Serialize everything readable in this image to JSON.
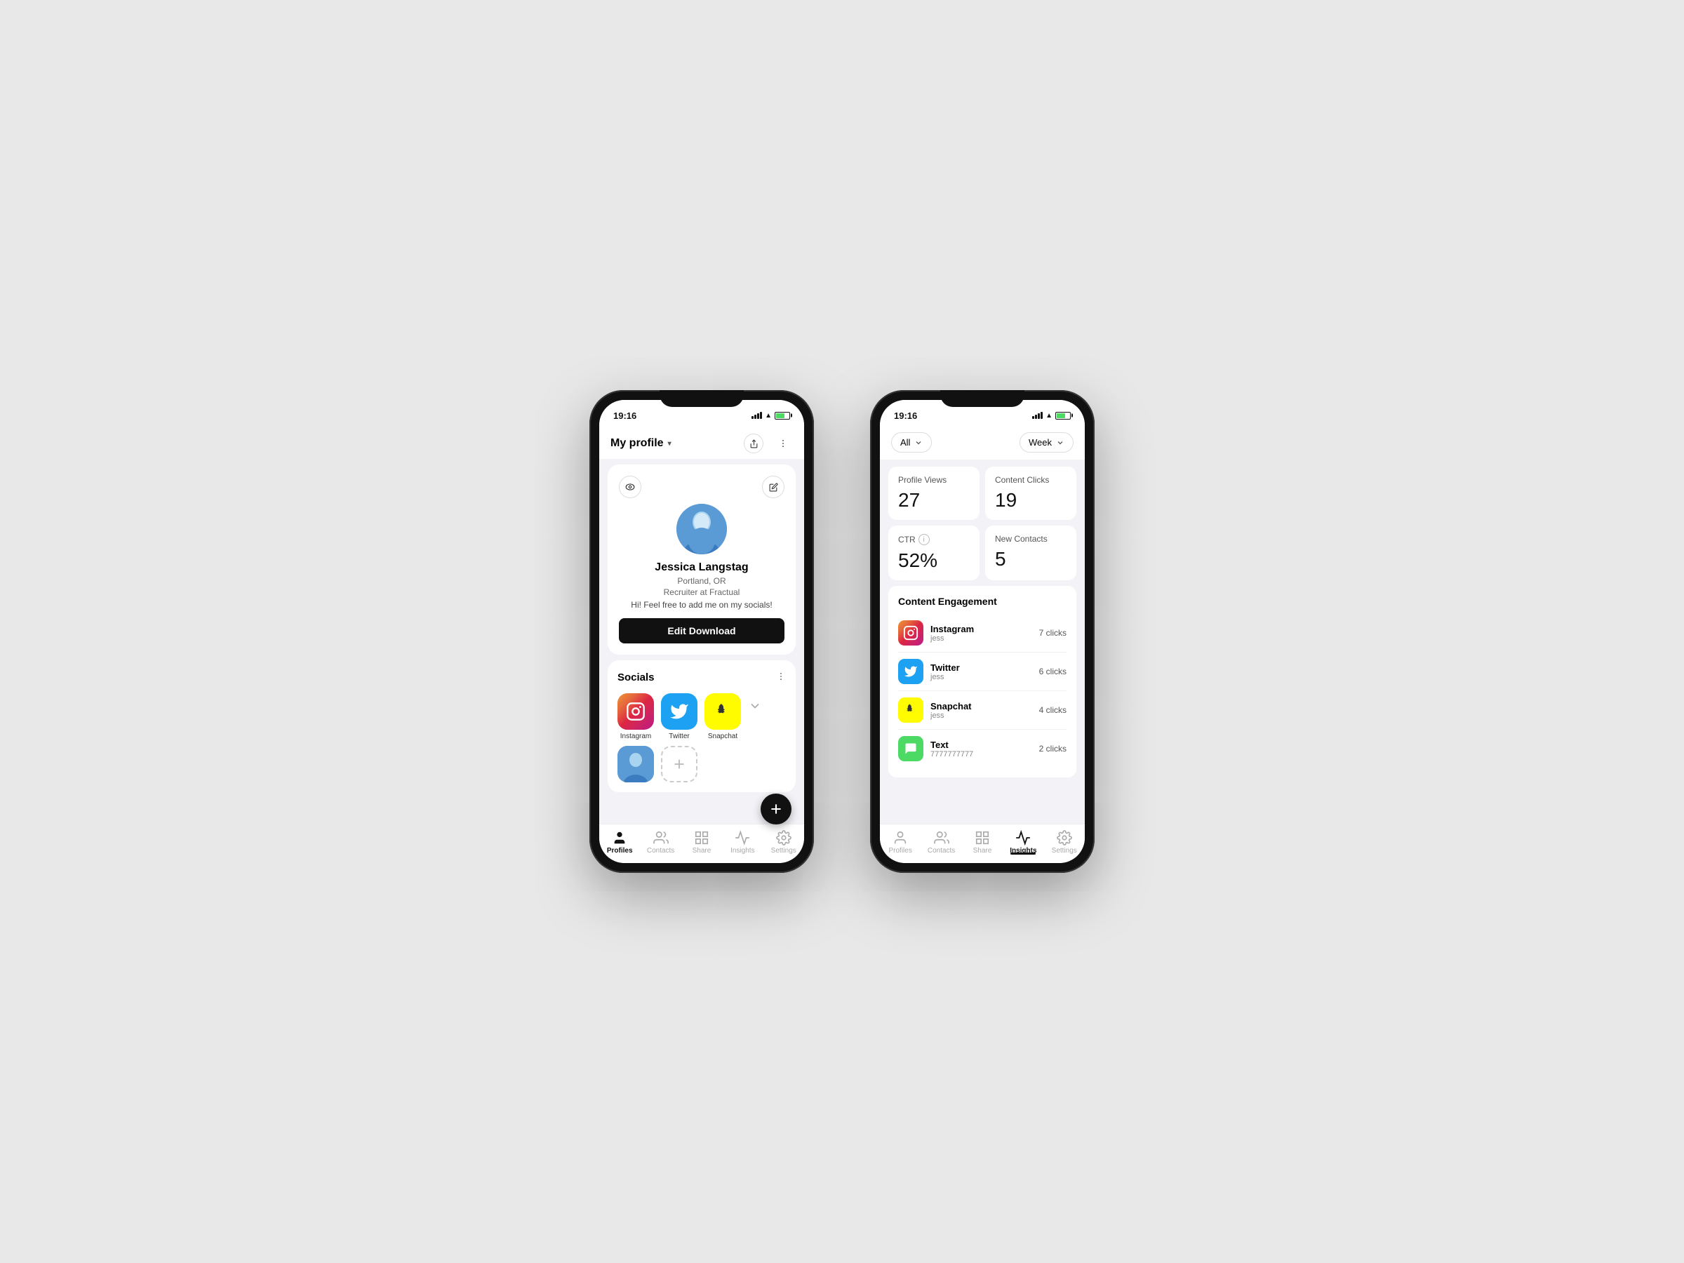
{
  "left_phone": {
    "status_time": "19:16",
    "header": {
      "title": "My profile",
      "share_label": "↑",
      "more_label": "⋮"
    },
    "profile": {
      "name": "Jessica Langstag",
      "location": "Portland, OR",
      "job_title": "Recruiter at Fractual",
      "bio": "Hi! Feel free to add me on my socials!",
      "edit_button": "Edit Download"
    },
    "socials": {
      "title": "Socials",
      "items": [
        {
          "name": "Instagram",
          "platform": "instagram"
        },
        {
          "name": "Twitter",
          "platform": "twitter"
        },
        {
          "name": "Snapchat",
          "platform": "snapchat"
        }
      ]
    },
    "nav": {
      "items": [
        {
          "label": "Profiles",
          "active": true
        },
        {
          "label": "Contacts",
          "active": false
        },
        {
          "label": "Share",
          "active": false
        },
        {
          "label": "Insights",
          "active": false
        },
        {
          "label": "Settings",
          "active": false
        }
      ]
    }
  },
  "right_phone": {
    "status_time": "19:16",
    "filters": {
      "all_label": "All",
      "period_label": "Week"
    },
    "metrics": [
      {
        "label": "Profile Views",
        "value": "27",
        "has_info": false
      },
      {
        "label": "Content Clicks",
        "value": "19",
        "has_info": false
      },
      {
        "label": "CTR",
        "value": "52%",
        "has_info": true
      },
      {
        "label": "New Contacts",
        "value": "5",
        "has_info": false
      }
    ],
    "engagement": {
      "title": "Content Engagement",
      "items": [
        {
          "name": "Instagram",
          "handle": "jess",
          "clicks": "7 clicks",
          "platform": "instagram"
        },
        {
          "name": "Twitter",
          "handle": "jess",
          "clicks": "6 clicks",
          "platform": "twitter"
        },
        {
          "name": "Snapchat",
          "handle": "jess",
          "clicks": "4 clicks",
          "platform": "snapchat"
        },
        {
          "name": "Text",
          "handle": "7777777777",
          "clicks": "2 clicks",
          "platform": "text"
        }
      ]
    },
    "nav": {
      "items": [
        {
          "label": "Profiles",
          "active": false
        },
        {
          "label": "Contacts",
          "active": false
        },
        {
          "label": "Share",
          "active": false
        },
        {
          "label": "Insights",
          "active": true
        },
        {
          "label": "Settings",
          "active": false
        }
      ]
    }
  }
}
